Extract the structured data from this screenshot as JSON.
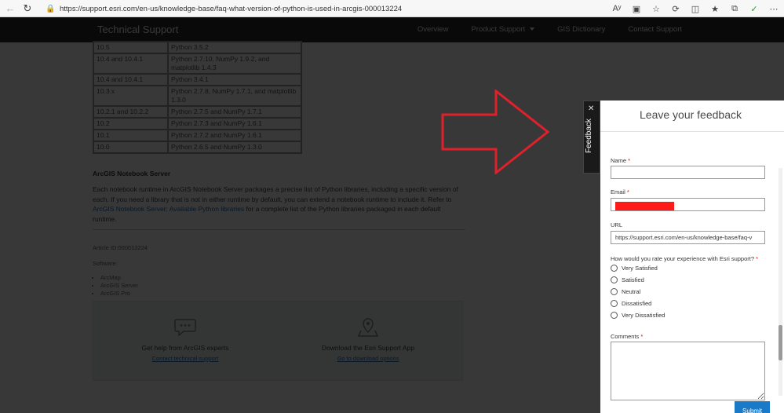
{
  "browser": {
    "url": "https://support.esri.com/en-us/knowledge-base/faq-what-version-of-python-is-used-in-arcgis-000013224",
    "zoom_icon": "Aʸ"
  },
  "header": {
    "title": "Technical Support",
    "nav": [
      {
        "label": "Overview"
      },
      {
        "label": "Product Support"
      },
      {
        "label": "GIS Dictionary"
      },
      {
        "label": "Contact Support"
      }
    ]
  },
  "versions_table": [
    {
      "version": "10.5",
      "python": "Python 3.5.2"
    },
    {
      "version": "10.4 and 10.4.1",
      "python": "Python 2.7.10, NumPy 1.9.2, and matplotlib 1.4.3"
    },
    {
      "version": "10.4 and 10.4.1",
      "python": "Python 3.4.1"
    },
    {
      "version": "10.3.x",
      "python": "Python 2.7.8, NumPy 1.7.1, and matplotlib 1.3.0"
    },
    {
      "version": "10.2.1 and 10.2.2",
      "python": "Python 2.7.5 and NumPy 1.7.1"
    },
    {
      "version": "10.2",
      "python": "Python 2.7.3 and NumPy 1.6.1"
    },
    {
      "version": "10.1",
      "python": "Python 2.7.2 and NumPy 1.6.1"
    },
    {
      "version": "10.0",
      "python": "Python 2.6.5 and NumPy 1.3.0"
    }
  ],
  "notebook": {
    "title": "ArcGIS Notebook Server",
    "para_part1": "Each notebook runtime in ArcGIS Notebook Server packages a precise list of Python libraries, including a specific version of each. If you need a library that is not in either runtime by default, you can extend a notebook runtime to include it. Refer to ",
    "link": "ArcGIS Notebook Server: Available Python libraries",
    "para_part2": " for a complete list of the Python libraries packaged in each default runtime."
  },
  "article": {
    "id_text": "Article ID:000013224",
    "software_label": "Software:",
    "software": [
      "ArcMap",
      "ArcGIS Server",
      "ArcGIS Pro"
    ]
  },
  "help": {
    "left_title": "Get help from ArcGIS experts",
    "left_link": "Contact technical support",
    "right_title": "Download the Esri Support App",
    "right_link": "Go to download options"
  },
  "feedback": {
    "tab_label": "Feedback",
    "title": "Leave your feedback",
    "name_label": "Name",
    "email_label": "Email",
    "url_label": "URL",
    "url_value": "https://support.esri.com/en-us/knowledge-base/faq-v",
    "rating_question": "How would you rate your experience with Esri support?",
    "rating_options": [
      "Very Satisfied",
      "Satisfied",
      "Neutral",
      "Dissatisfied",
      "Very Dissatisfied"
    ],
    "comments_label": "Comments",
    "submit_label": "Submit",
    "required_mark": "*"
  },
  "colors": {
    "header_bg": "#2b2b2b",
    "accent_blue": "#1a7ac8",
    "annotation_red": "#e0202a"
  }
}
